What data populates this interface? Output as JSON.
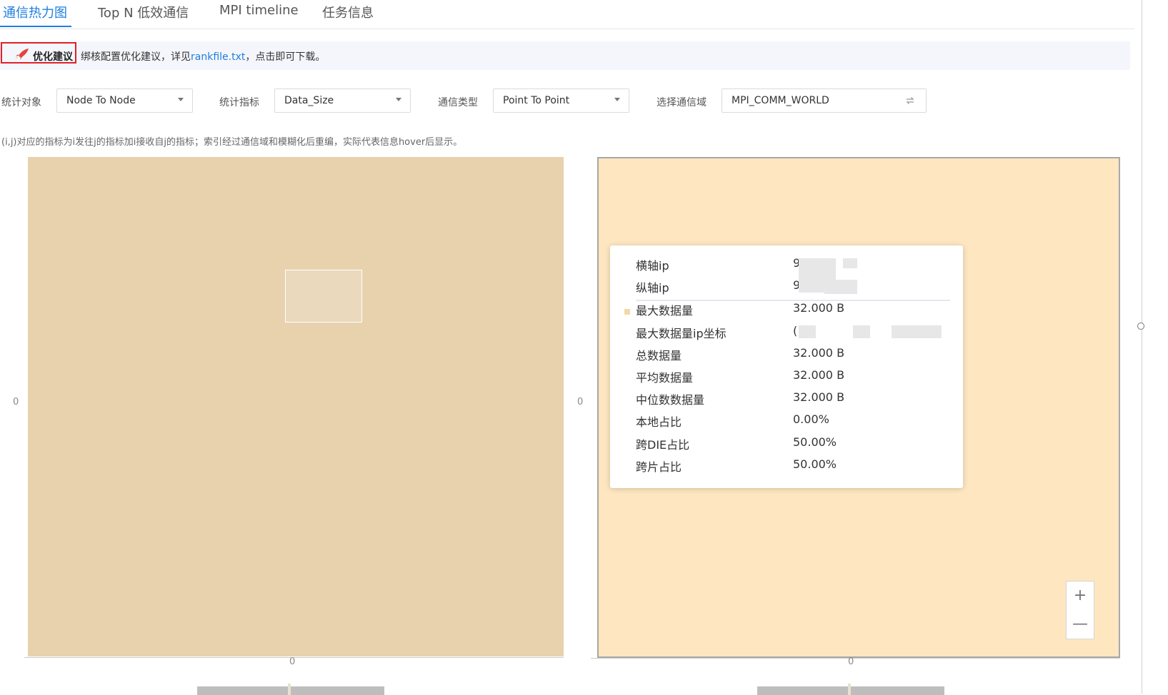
{
  "tabs": [
    {
      "label": "通信热力图",
      "active": true
    },
    {
      "label": "Top N 低效通信",
      "active": false
    },
    {
      "label": "MPI timeline",
      "active": false
    },
    {
      "label": "任务信息",
      "active": false
    }
  ],
  "advice": {
    "badge": "优化建议",
    "text_before": "绑核配置优化建议，详见",
    "link": "rankfile.txt",
    "text_after": "，点击即可下载。"
  },
  "filters": {
    "object_label": "统计对象",
    "object_value": "Node To Node",
    "metric_label": "统计指标",
    "metric_value": "Data_Size",
    "type_label": "通信类型",
    "type_value": "Point To Point",
    "domain_label": "选择通信域",
    "domain_value": "MPI_COMM_WORLD"
  },
  "hint": "(i,j)对应的指标为i发往j的指标加i接收自j的指标；索引经过通信域和模糊化后重编，实际代表信息hover后显示。",
  "left_chart": {
    "y_tick": "0",
    "x_tick": "0"
  },
  "right_chart": {
    "y_tick": "0",
    "x_tick": "0"
  },
  "tooltip": {
    "x_ip_label": "横轴ip",
    "x_ip_value": "9",
    "y_ip_label": "纵轴ip",
    "y_ip_value": "9",
    "rows": [
      {
        "label": "最大数据量",
        "value": "32.000 B"
      },
      {
        "label": "最大数据量ip坐标",
        "value": "(                              )"
      },
      {
        "label": "总数据量",
        "value": "32.000 B"
      },
      {
        "label": "平均数据量",
        "value": "32.000 B"
      },
      {
        "label": "中位数数据量",
        "value": "32.000 B"
      },
      {
        "label": "本地占比",
        "value": "0.00%"
      },
      {
        "label": "跨DIE占比",
        "value": "50.00%"
      },
      {
        "label": "跨片占比",
        "value": "50.00%"
      }
    ]
  },
  "zoom": {
    "in": "+",
    "out": "—"
  },
  "colors": {
    "accent": "#1f7ee0",
    "heat_left": "#e8d2ad",
    "heat_right": "#fde6c0",
    "badge_border": "#e0202a"
  }
}
